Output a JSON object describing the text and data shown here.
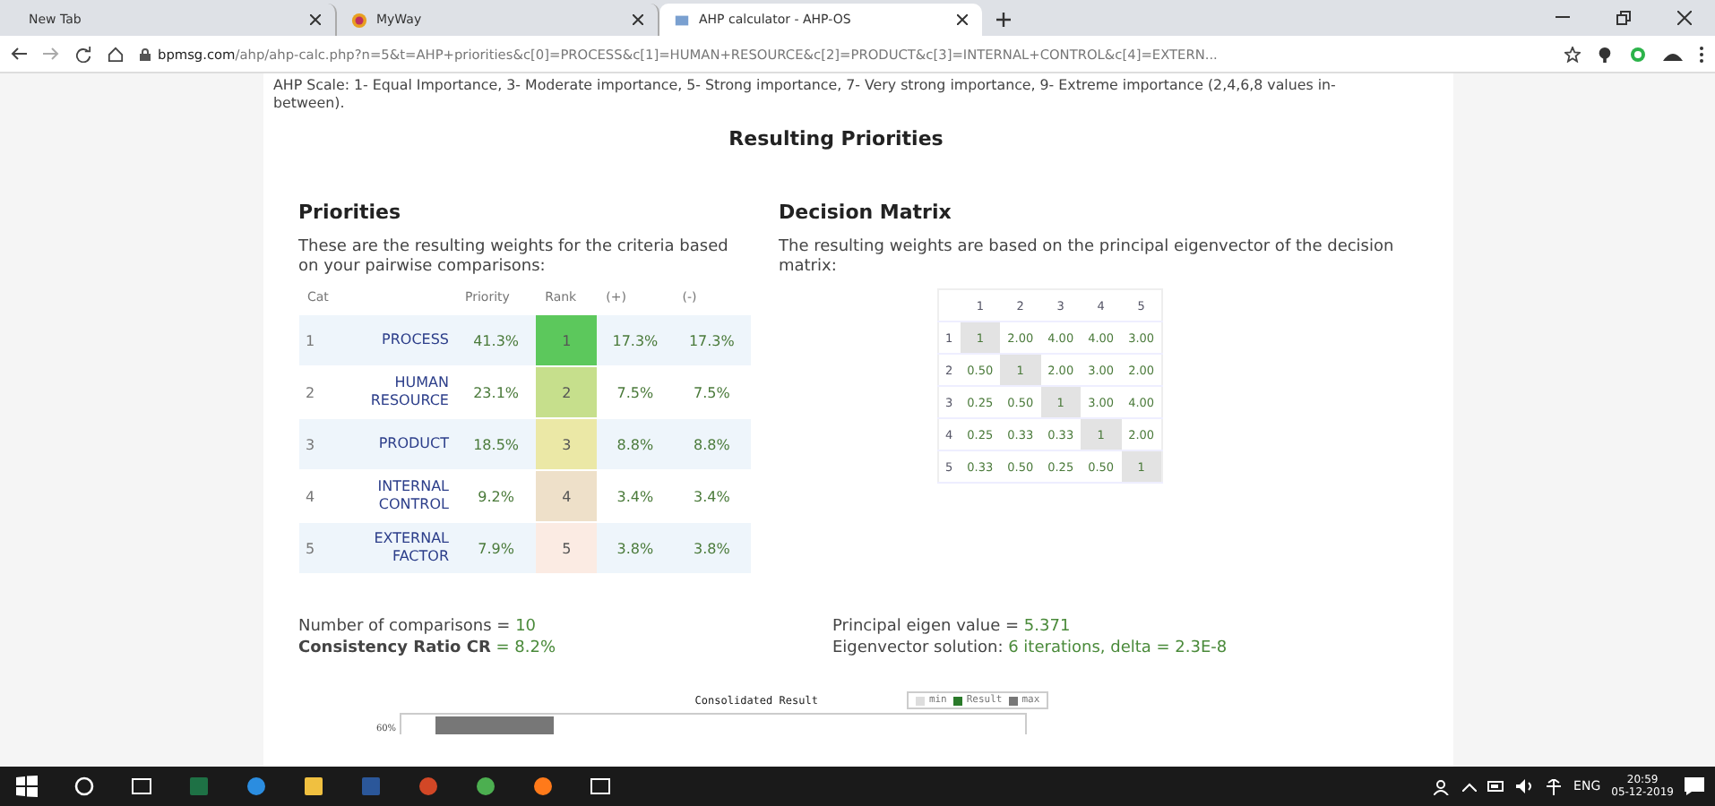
{
  "browser": {
    "tabs": [
      {
        "title": "New Tab",
        "selected": false
      },
      {
        "title": "MyWay",
        "selected": false
      },
      {
        "title": "AHP calculator - AHP-OS",
        "selected": true
      }
    ],
    "address": {
      "host": "bpmsg.com",
      "path": "/ahp/ahp-calc.php?n=5&t=AHP+priorities&c[0]=PROCESS&c[1]=HUMAN+RESOURCE&c[2]=PRODUCT&c[3]=INTERNAL+CONTROL&c[4]=EXTERN..."
    }
  },
  "scale_note": "AHP Scale: 1- Equal Importance, 3- Moderate importance, 5- Strong importance, 7- Very strong importance, 9- Extreme importance (2,4,6,8 values in-between).",
  "title": "Resulting Priorities",
  "priorities": {
    "heading": "Priorities",
    "description": "These are the resulting weights for the criteria based on your pairwise comparisons:",
    "columns": [
      "Cat",
      "Priority",
      "Rank",
      "(+)",
      "(-)"
    ],
    "rows": [
      {
        "cat": "1",
        "name": "PROCESS",
        "priority": "41.3%",
        "rank": "1",
        "color": "#5cc85c",
        "plus": "17.3%",
        "minus": "17.3%"
      },
      {
        "cat": "2",
        "name": "HUMAN RESOURCE",
        "priority": "23.1%",
        "rank": "2",
        "color": "#c6df8c",
        "plus": "7.5%",
        "minus": "7.5%"
      },
      {
        "cat": "3",
        "name": "PRODUCT",
        "priority": "18.5%",
        "rank": "3",
        "color": "#ebe8a6",
        "plus": "8.8%",
        "minus": "8.8%"
      },
      {
        "cat": "4",
        "name": "INTERNAL CONTROL",
        "priority": "9.2%",
        "rank": "4",
        "color": "#eee0c9",
        "plus": "3.4%",
        "minus": "3.4%"
      },
      {
        "cat": "5",
        "name": "EXTERNAL FACTOR",
        "priority": "7.9%",
        "rank": "5",
        "color": "#fbebe3",
        "plus": "3.8%",
        "minus": "3.8%"
      }
    ]
  },
  "matrix": {
    "heading": "Decision Matrix",
    "description": "The resulting weights are based on the principal eigenvector of the decision matrix:",
    "columns": [
      "1",
      "2",
      "3",
      "4",
      "5"
    ],
    "rows": [
      {
        "label": "1",
        "values": [
          "1",
          "2.00",
          "4.00",
          "4.00",
          "3.00"
        ]
      },
      {
        "label": "2",
        "values": [
          "0.50",
          "1",
          "2.00",
          "3.00",
          "2.00"
        ]
      },
      {
        "label": "3",
        "values": [
          "0.25",
          "0.50",
          "1",
          "3.00",
          "4.00"
        ]
      },
      {
        "label": "4",
        "values": [
          "0.25",
          "0.33",
          "0.33",
          "1",
          "2.00"
        ]
      },
      {
        "label": "5",
        "values": [
          "0.33",
          "0.50",
          "0.25",
          "0.50",
          "1"
        ]
      }
    ]
  },
  "stats_left": [
    {
      "label": "Number of comparisons = ",
      "value": "10",
      "bold": false
    },
    {
      "label": "Consistency Ratio CR",
      "value": " = 8.2%",
      "bold": true
    }
  ],
  "stats_right": [
    {
      "label": "Principal eigen value = ",
      "value": "5.371"
    },
    {
      "label": "Eigenvector solution: ",
      "value": "6 iterations, delta = 2.3E-8"
    }
  ],
  "chart": {
    "title": "Consolidated Result",
    "legend": [
      "min",
      "Result",
      "max"
    ],
    "y_tick": "60%"
  },
  "taskbar": {
    "language": "ENG",
    "time": "20:59",
    "date": "05-12-2019"
  }
}
